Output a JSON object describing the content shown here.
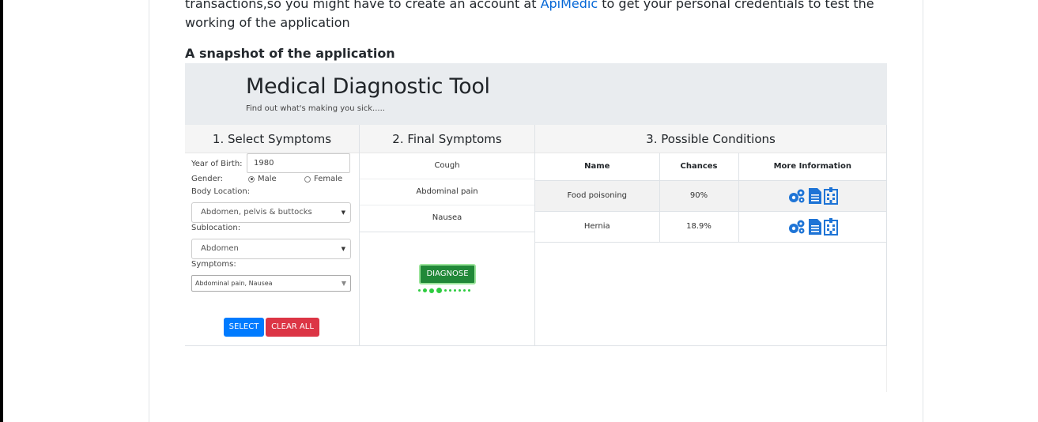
{
  "intro": {
    "text_before": "transactions,so you might have to create an account at ",
    "link_text": "ApiMedic",
    "text_after": " to get your personal credentials to test the working of the application"
  },
  "snapshot_heading": "A snapshot of the application",
  "app": {
    "title": "Medical Diagnostic Tool",
    "subtitle": "Find out what's making you sick.....",
    "columns": {
      "select": "1. Select Symptoms",
      "final": "2. Final Symptoms",
      "conditions": "3. Possible Conditions"
    },
    "form": {
      "yob_label": "Year of Birth:",
      "yob_value": "1980",
      "gender_label": "Gender:",
      "male_label": "Male",
      "female_label": "Female",
      "gender_selected": "Male",
      "body_location_label": "Body Location:",
      "body_location_value": "Abdomen, pelvis & buttocks",
      "sublocation_label": "Sublocation:",
      "sublocation_value": "Abdomen",
      "symptoms_label": "Symptoms:",
      "symptoms_value": "Abdominal pain, Nausea",
      "select_button": "SELECT",
      "clear_button": "CLEAR ALL"
    },
    "final_symptoms": [
      "Cough",
      "Abdominal pain",
      "Nausea"
    ],
    "diagnose_button": "DIAGNOSE",
    "conditions_table": {
      "headers": [
        "Name",
        "Chances",
        "More Information"
      ],
      "rows": [
        {
          "name": "Food poisoning",
          "chance": "90%"
        },
        {
          "name": "Hernia",
          "chance": "18.9%"
        }
      ]
    },
    "colors": {
      "primary": "#007bff",
      "danger": "#dc3545",
      "success": "#218838",
      "icon_blue": "#1e74d6",
      "loader_green": "#2ecc40"
    }
  }
}
